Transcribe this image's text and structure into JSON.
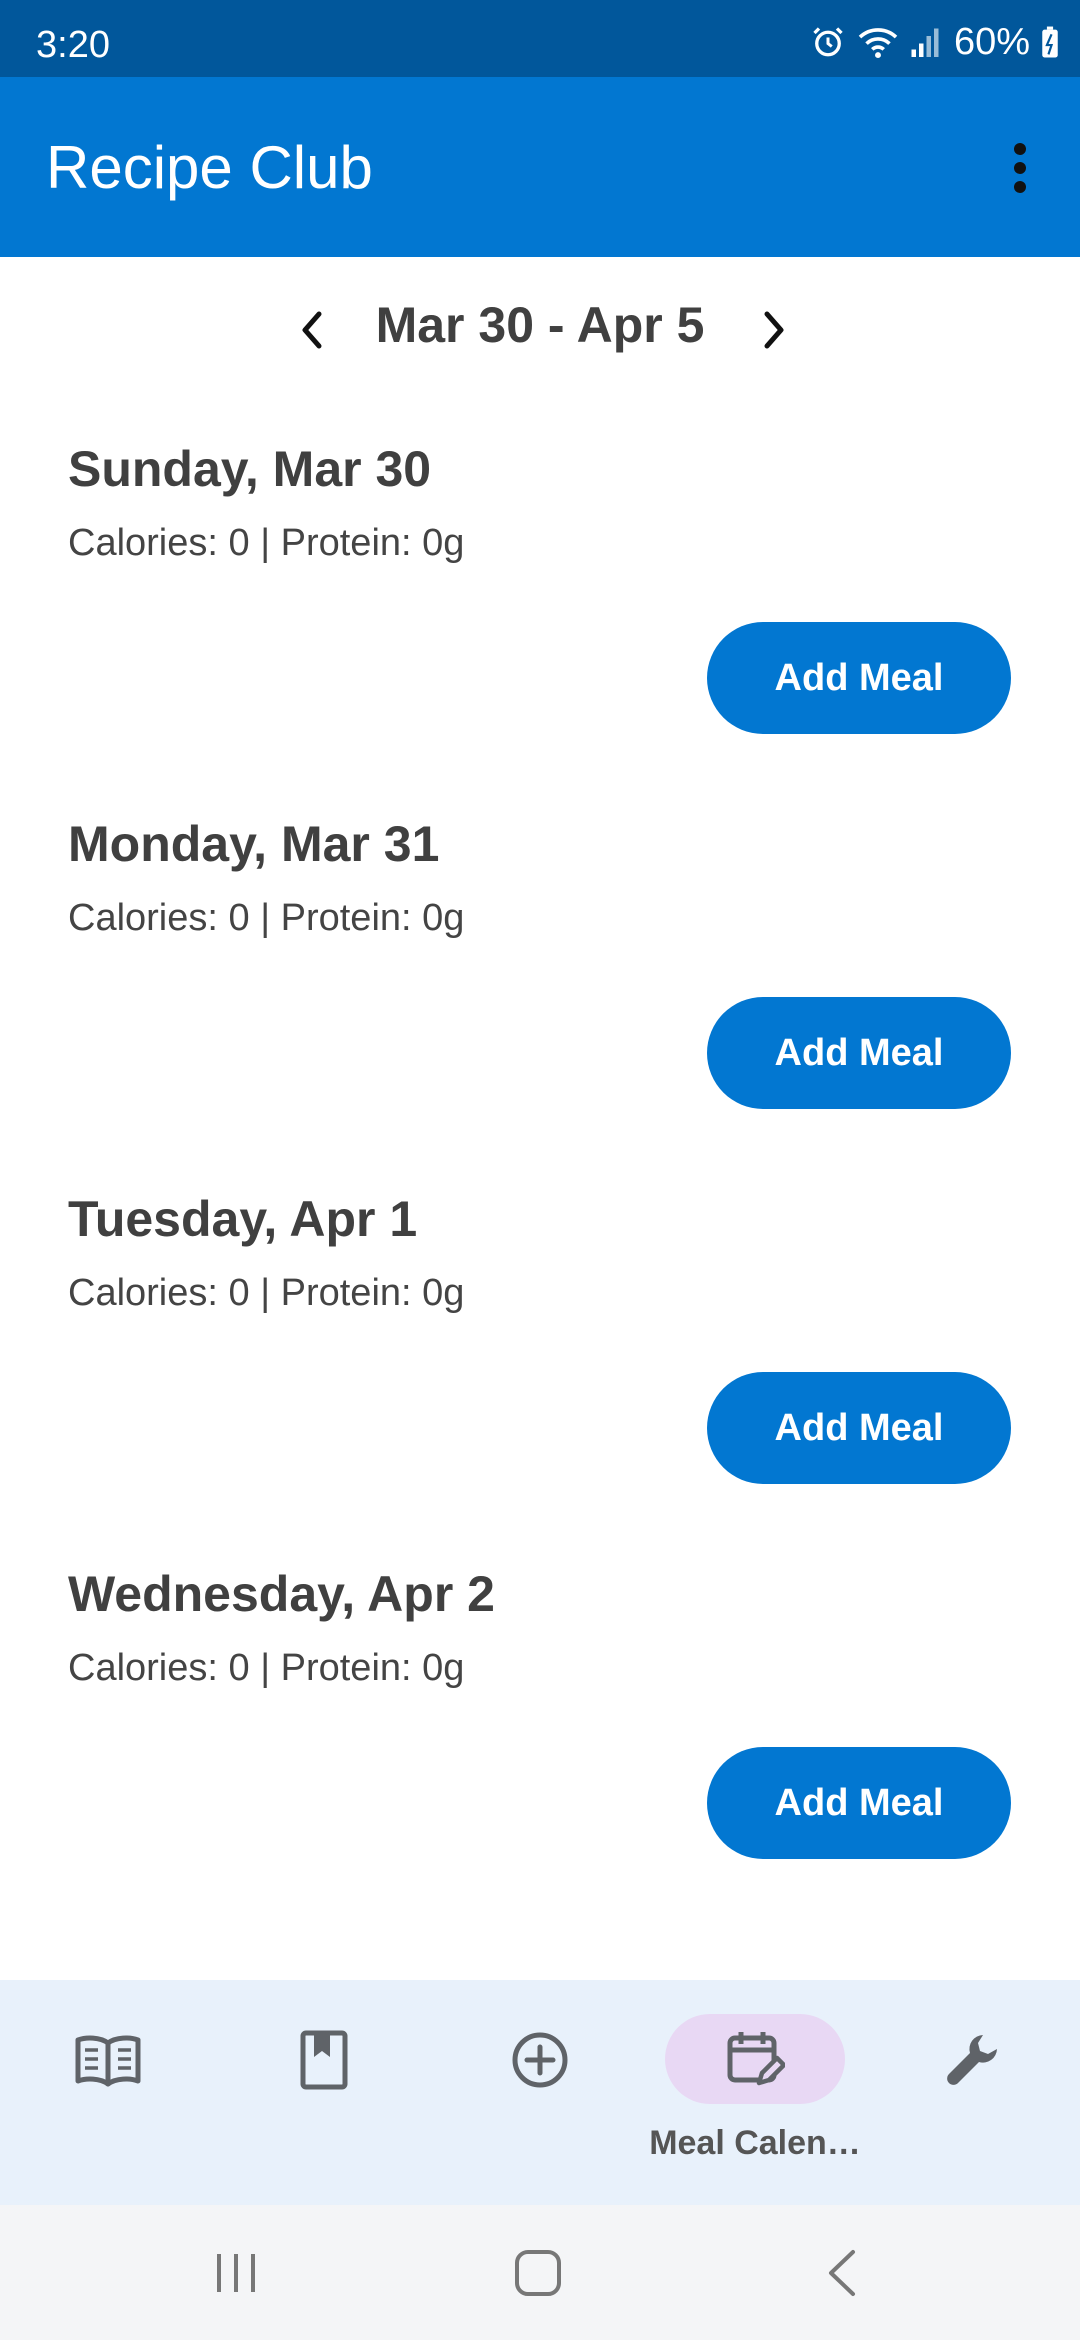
{
  "status_bar": {
    "time": "3:20",
    "battery": "60%",
    "icons": [
      "alarm-icon",
      "wifi-icon",
      "signal-icon",
      "battery-icon"
    ]
  },
  "app_bar": {
    "title": "Recipe Club",
    "menu_icon": "overflow-menu-icon"
  },
  "week_nav": {
    "range": "Mar 30 - Apr 5"
  },
  "days": [
    {
      "title": "Sunday, Mar 30",
      "stats": "Calories: 0 | Protein: 0g",
      "button": "Add Meal"
    },
    {
      "title": "Monday, Mar 31",
      "stats": "Calories: 0 | Protein: 0g",
      "button": "Add Meal"
    },
    {
      "title": "Tuesday, Apr 1",
      "stats": "Calories: 0 | Protein: 0g",
      "button": "Add Meal"
    },
    {
      "title": "Wednesday, Apr 2",
      "stats": "Calories: 0 | Protein: 0g",
      "button": "Add Meal"
    }
  ],
  "bottom_nav": {
    "items": [
      {
        "icon": "book-open-icon"
      },
      {
        "icon": "bookmark-book-icon"
      },
      {
        "icon": "add-circle-icon"
      },
      {
        "icon": "calendar-edit-icon",
        "label": "Meal Calen…",
        "active": true
      },
      {
        "icon": "wrench-icon"
      }
    ]
  },
  "colors": {
    "status_bar": "#01579b",
    "app_bar": "#0277d1",
    "primary_button": "#0277d1",
    "bottom_nav_bg": "#e8f1fb",
    "active_indicator": "#e8d8f4"
  }
}
